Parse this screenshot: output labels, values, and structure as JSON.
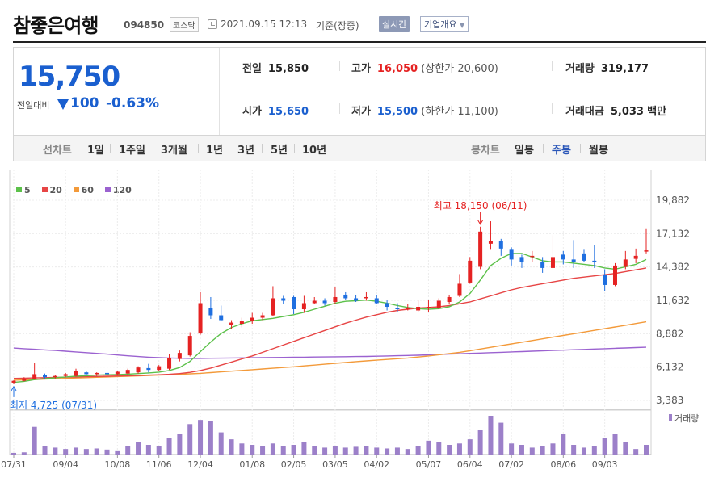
{
  "header": {
    "stock_name": "참좋은여행",
    "stock_code": "094850",
    "market_badge": "코스닥",
    "datetime": "2021.09.15 12:13",
    "basis": "기준(장중)",
    "realtime_button": "실시간",
    "company_overview_button": "기업개요",
    "clock_icon": "clock-icon"
  },
  "quote": {
    "price": "15,750",
    "change_label": "전일대비",
    "change_amount": "100",
    "change_pct": "-0.63%",
    "down_color": "#1a5fcf",
    "up_color": "#e52222",
    "items": {
      "prev_label": "전일",
      "prev_value": "15,850",
      "high_label": "고가",
      "high_value": "16,050",
      "upper_limit": "(상한가 20,600)",
      "volume_label": "거래량",
      "volume_value": "319,177",
      "open_label": "시가",
      "open_value": "15,650",
      "low_label": "저가",
      "low_value": "15,500",
      "lower_limit": "(하한가 11,100)",
      "amount_label": "거래대금",
      "amount_value": "5,033",
      "amount_unit": "백만"
    }
  },
  "period_bar": {
    "line_label": "선차트",
    "line_options": [
      "1일",
      "1주일",
      "3개월",
      "1년",
      "3년",
      "5년",
      "10년"
    ],
    "candle_label": "봉차트",
    "candle_options": [
      "일봉",
      "주봉",
      "월봉"
    ],
    "selected_candle": "주봉",
    "selected_color": "#2a56b8"
  },
  "chart_data": {
    "type": "candlestick",
    "period": "weekly",
    "legend": [
      {
        "name": "5",
        "color": "#5cc14a"
      },
      {
        "name": "20",
        "color": "#e74545"
      },
      {
        "name": "60",
        "color": "#f39a3a"
      },
      {
        "name": "120",
        "color": "#9b62d0"
      }
    ],
    "y_ticks": [
      3383,
      6132,
      8882,
      11632,
      14382,
      17132,
      19882
    ],
    "y_tick_labels": [
      "3,383",
      "6,132",
      "8,882",
      "11,632",
      "14,382",
      "17,132",
      "19,882"
    ],
    "ylim": [
      3383,
      19882
    ],
    "x_tick_labels": [
      "07/31",
      "09/04",
      "10/08",
      "11/06",
      "12/04",
      "01/08",
      "02/05",
      "03/05",
      "04/02",
      "05/07",
      "06/04",
      "07/02",
      "08/06",
      "09/03"
    ],
    "x_tick_week_index": [
      0,
      5,
      10,
      14,
      18,
      23,
      27,
      31,
      35,
      40,
      44,
      48,
      53,
      57
    ],
    "high_annotation": "최고 18,150 (06/11)",
    "high_week_index": 45,
    "low_annotation": "최저 4,725 (07/31)",
    "low_week_index": 0,
    "up_color": "#e52222",
    "down_color": "#1f6fe0",
    "candles": [
      {
        "o": 4850,
        "h": 5050,
        "l": 4725,
        "c": 5000
      },
      {
        "o": 5000,
        "h": 5300,
        "l": 4950,
        "c": 5150
      },
      {
        "o": 5150,
        "h": 6500,
        "l": 5100,
        "c": 5550
      },
      {
        "o": 5500,
        "h": 5600,
        "l": 5150,
        "c": 5300
      },
      {
        "o": 5300,
        "h": 5500,
        "l": 5200,
        "c": 5400
      },
      {
        "o": 5400,
        "h": 5650,
        "l": 5300,
        "c": 5550
      },
      {
        "o": 5400,
        "h": 6000,
        "l": 5350,
        "c": 5800
      },
      {
        "o": 5700,
        "h": 5800,
        "l": 5450,
        "c": 5550
      },
      {
        "o": 5550,
        "h": 5700,
        "l": 5400,
        "c": 5650
      },
      {
        "o": 5650,
        "h": 5750,
        "l": 5500,
        "c": 5600
      },
      {
        "o": 5550,
        "h": 5800,
        "l": 5450,
        "c": 5750
      },
      {
        "o": 5600,
        "h": 6000,
        "l": 5500,
        "c": 5900
      },
      {
        "o": 5700,
        "h": 6200,
        "l": 5600,
        "c": 6100
      },
      {
        "o": 6050,
        "h": 6400,
        "l": 5700,
        "c": 5900
      },
      {
        "o": 5900,
        "h": 6300,
        "l": 5800,
        "c": 6200
      },
      {
        "o": 6000,
        "h": 7200,
        "l": 5900,
        "c": 6900
      },
      {
        "o": 6800,
        "h": 7500,
        "l": 6600,
        "c": 7300
      },
      {
        "o": 7100,
        "h": 9000,
        "l": 7000,
        "c": 8700
      },
      {
        "o": 8900,
        "h": 12300,
        "l": 8800,
        "c": 11400
      },
      {
        "o": 11000,
        "h": 11900,
        "l": 10100,
        "c": 10400
      },
      {
        "o": 10400,
        "h": 11200,
        "l": 9900,
        "c": 10000
      },
      {
        "o": 9600,
        "h": 10000,
        "l": 9300,
        "c": 9800
      },
      {
        "o": 9700,
        "h": 10200,
        "l": 9400,
        "c": 9900
      },
      {
        "o": 9900,
        "h": 10600,
        "l": 9700,
        "c": 10200
      },
      {
        "o": 10200,
        "h": 10600,
        "l": 10000,
        "c": 10400
      },
      {
        "o": 10400,
        "h": 12800,
        "l": 10300,
        "c": 11800
      },
      {
        "o": 11800,
        "h": 12000,
        "l": 11300,
        "c": 11600
      },
      {
        "o": 11900,
        "h": 12000,
        "l": 10500,
        "c": 10900
      },
      {
        "o": 10900,
        "h": 12000,
        "l": 10600,
        "c": 11400
      },
      {
        "o": 11400,
        "h": 11900,
        "l": 11300,
        "c": 11600
      },
      {
        "o": 11600,
        "h": 11800,
        "l": 11200,
        "c": 11400
      },
      {
        "o": 11500,
        "h": 12700,
        "l": 11300,
        "c": 11900
      },
      {
        "o": 12100,
        "h": 12300,
        "l": 11700,
        "c": 11800
      },
      {
        "o": 11800,
        "h": 12100,
        "l": 11500,
        "c": 11600
      },
      {
        "o": 11800,
        "h": 12300,
        "l": 11600,
        "c": 11900
      },
      {
        "o": 11800,
        "h": 12100,
        "l": 11300,
        "c": 11400
      },
      {
        "o": 11400,
        "h": 11700,
        "l": 10800,
        "c": 11100
      },
      {
        "o": 11000,
        "h": 11400,
        "l": 10700,
        "c": 10900
      },
      {
        "o": 10900,
        "h": 11300,
        "l": 10800,
        "c": 11000
      },
      {
        "o": 10800,
        "h": 11700,
        "l": 10700,
        "c": 11100
      },
      {
        "o": 11000,
        "h": 11700,
        "l": 10700,
        "c": 11100
      },
      {
        "o": 11000,
        "h": 11800,
        "l": 10900,
        "c": 11600
      },
      {
        "o": 11500,
        "h": 12100,
        "l": 11300,
        "c": 11900
      },
      {
        "o": 12000,
        "h": 13800,
        "l": 11900,
        "c": 13000
      },
      {
        "o": 13100,
        "h": 15200,
        "l": 13000,
        "c": 14900
      },
      {
        "o": 14400,
        "h": 17700,
        "l": 14200,
        "c": 17300
      },
      {
        "o": 16300,
        "h": 18150,
        "l": 15800,
        "c": 16500
      },
      {
        "o": 16500,
        "h": 16700,
        "l": 15300,
        "c": 15900
      },
      {
        "o": 15800,
        "h": 16000,
        "l": 14500,
        "c": 15000
      },
      {
        "o": 15200,
        "h": 15400,
        "l": 14300,
        "c": 14800
      },
      {
        "o": 15300,
        "h": 15700,
        "l": 14800,
        "c": 15300
      },
      {
        "o": 14800,
        "h": 15200,
        "l": 13900,
        "c": 14300
      },
      {
        "o": 14300,
        "h": 17000,
        "l": 14200,
        "c": 15200
      },
      {
        "o": 15400,
        "h": 15700,
        "l": 14600,
        "c": 15000
      },
      {
        "o": 15000,
        "h": 16600,
        "l": 14300,
        "c": 14800
      },
      {
        "o": 15500,
        "h": 15800,
        "l": 14800,
        "c": 14900
      },
      {
        "o": 14900,
        "h": 16200,
        "l": 14300,
        "c": 14800
      },
      {
        "o": 13700,
        "h": 14200,
        "l": 12400,
        "c": 12900
      },
      {
        "o": 12900,
        "h": 14700,
        "l": 12800,
        "c": 14500
      },
      {
        "o": 14400,
        "h": 15700,
        "l": 14200,
        "c": 15000
      },
      {
        "o": 15050,
        "h": 15900,
        "l": 14700,
        "c": 15300
      },
      {
        "o": 15650,
        "h": 17500,
        "l": 15500,
        "c": 15750
      }
    ],
    "ma5": [
      4870,
      4950,
      5100,
      5180,
      5250,
      5320,
      5380,
      5420,
      5470,
      5500,
      5520,
      5550,
      5600,
      5650,
      5720,
      5850,
      6100,
      6600,
      7400,
      8200,
      8900,
      9400,
      9700,
      9950,
      10050,
      10150,
      10300,
      10450,
      10650,
      10900,
      11150,
      11400,
      11550,
      11600,
      11650,
      11550,
      11400,
      11200,
      11050,
      10950,
      10900,
      10950,
      11100,
      11500,
      12200,
      13300,
      14500,
      15100,
      15500,
      15500,
      15200,
      14900,
      14800,
      14800,
      14700,
      14600,
      14500,
      14300,
      14200,
      14400,
      14600,
      15000
    ],
    "ma20": [
      5200,
      5220,
      5240,
      5260,
      5280,
      5300,
      5320,
      5340,
      5360,
      5380,
      5400,
      5420,
      5440,
      5470,
      5500,
      5540,
      5600,
      5700,
      5850,
      6050,
      6300,
      6550,
      6800,
      7050,
      7350,
      7650,
      7950,
      8250,
      8550,
      8850,
      9150,
      9450,
      9750,
      10000,
      10250,
      10450,
      10650,
      10800,
      10900,
      11000,
      11050,
      11100,
      11200,
      11350,
      11500,
      11750,
      12000,
      12250,
      12500,
      12700,
      12850,
      13000,
      13150,
      13300,
      13450,
      13550,
      13650,
      13750,
      13850,
      14000,
      14150,
      14300
    ],
    "ma60": [
      5050,
      5080,
      5110,
      5140,
      5170,
      5200,
      5230,
      5260,
      5290,
      5320,
      5350,
      5380,
      5410,
      5440,
      5470,
      5500,
      5540,
      5580,
      5620,
      5680,
      5740,
      5800,
      5860,
      5920,
      5980,
      6040,
      6100,
      6160,
      6230,
      6300,
      6370,
      6440,
      6510,
      6580,
      6640,
      6700,
      6760,
      6820,
      6880,
      6960,
      7050,
      7150,
      7250,
      7350,
      7480,
      7620,
      7760,
      7900,
      8040,
      8180,
      8320,
      8460,
      8600,
      8740,
      8880,
      9020,
      9160,
      9300,
      9440,
      9580,
      9720,
      9860
    ],
    "ma120": [
      7700,
      7650,
      7600,
      7550,
      7500,
      7440,
      7380,
      7320,
      7260,
      7200,
      7130,
      7060,
      7000,
      6950,
      6910,
      6880,
      6860,
      6850,
      6850,
      6860,
      6870,
      6880,
      6890,
      6900,
      6910,
      6920,
      6930,
      6940,
      6950,
      6960,
      6970,
      6980,
      6990,
      7000,
      7010,
      7030,
      7050,
      7070,
      7090,
      7110,
      7140,
      7170,
      7200,
      7230,
      7260,
      7290,
      7320,
      7350,
      7380,
      7410,
      7440,
      7470,
      7500,
      7530,
      7560,
      7590,
      7620,
      7650,
      7680,
      7710,
      7740,
      7770
    ],
    "ma_colors": {
      "ma5": "#5cc14a",
      "ma20": "#e74545",
      "ma60": "#f39a3a",
      "ma120": "#9b62d0"
    },
    "volume_label": "거래량",
    "volume_color": "#9c80c9",
    "volume": [
      6,
      8,
      100,
      30,
      25,
      20,
      25,
      20,
      22,
      18,
      15,
      30,
      45,
      35,
      30,
      60,
      75,
      110,
      125,
      120,
      80,
      55,
      40,
      35,
      32,
      40,
      30,
      35,
      45,
      30,
      25,
      30,
      25,
      28,
      30,
      25,
      22,
      25,
      20,
      30,
      50,
      45,
      35,
      40,
      55,
      90,
      140,
      115,
      40,
      35,
      25,
      30,
      40,
      75,
      35,
      25,
      30,
      60,
      75,
      45,
      20,
      35
    ]
  }
}
